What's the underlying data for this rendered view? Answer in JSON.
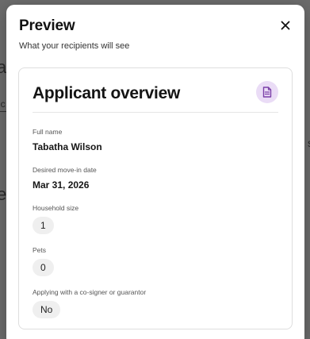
{
  "background": {
    "fragments": [
      "r",
      "a",
      "ic",
      "e",
      "s"
    ]
  },
  "modal": {
    "title": "Preview",
    "subtitle": "What your recipients will see",
    "close_icon": "close-icon"
  },
  "card": {
    "title": "Applicant overview",
    "badge_icon": "document-icon",
    "fields": {
      "full_name": {
        "label": "Full name",
        "value": "Tabatha Wilson"
      },
      "move_in": {
        "label": "Desired move-in date",
        "value": "Mar 31, 2026"
      },
      "household": {
        "label": "Household size",
        "value": "1"
      },
      "pets": {
        "label": "Pets",
        "value": "0"
      },
      "cosigner": {
        "label": "Applying with a co-signer or guarantor",
        "value": "No"
      }
    }
  },
  "colors": {
    "overlay": "#5a5a5a",
    "badge_bg": "#eadcf6",
    "badge_icon": "#7b3fa8",
    "pill_bg": "#efefef"
  }
}
